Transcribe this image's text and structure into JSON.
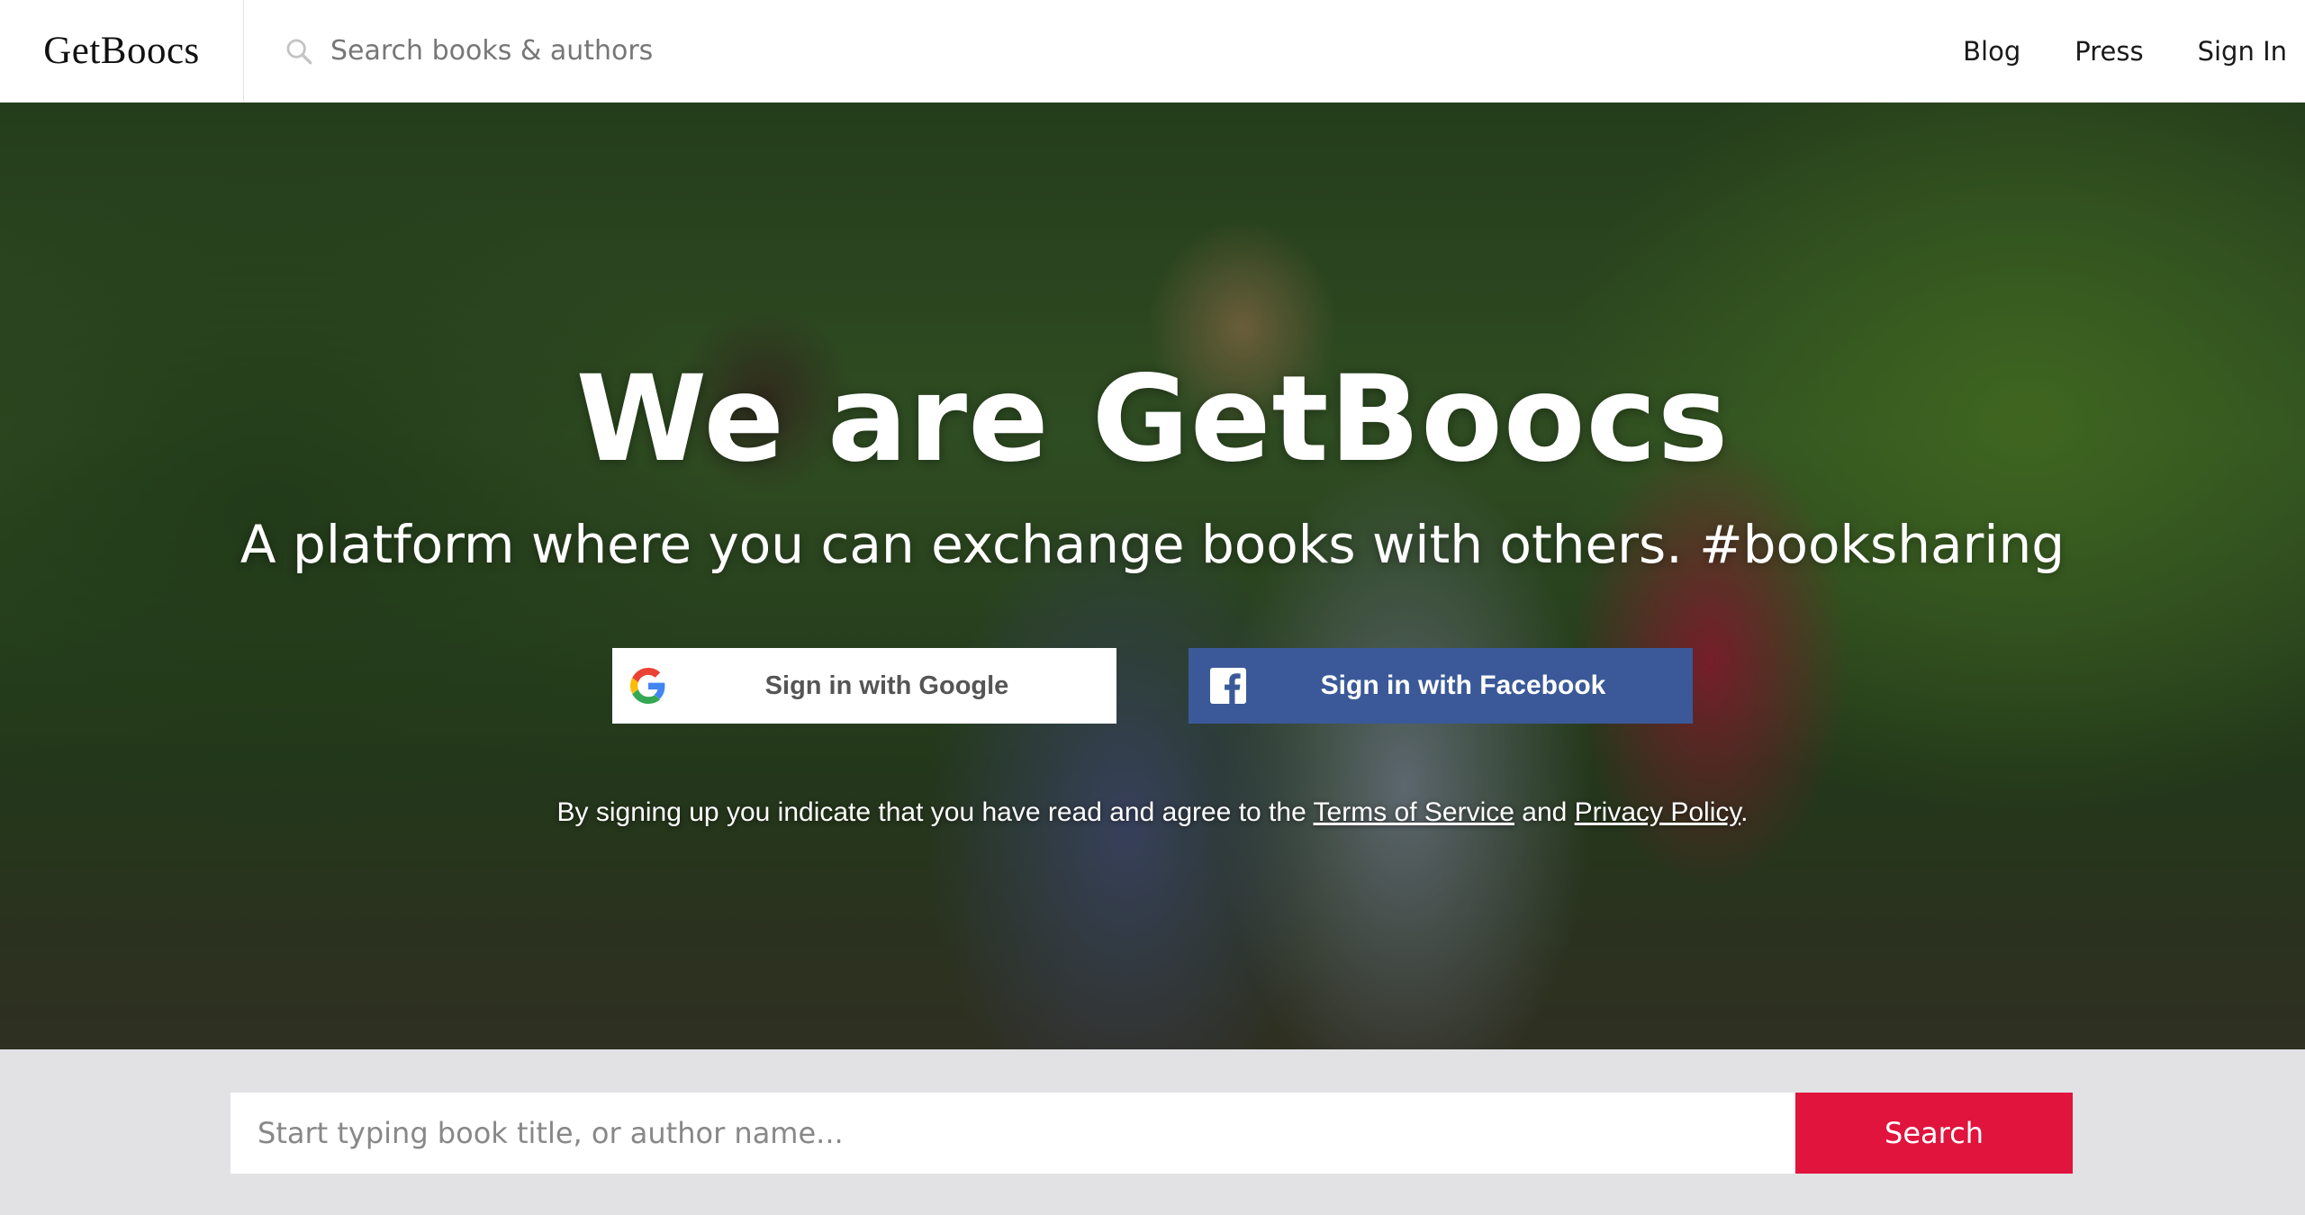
{
  "header": {
    "logo": "GetBoocs",
    "search_placeholder": "Search books & authors",
    "nav": {
      "blog": "Blog",
      "press": "Press",
      "sign_in": "Sign In"
    }
  },
  "hero": {
    "title": "We are GetBoocs",
    "subtitle": "A platform where you can exchange books with others. #booksharing",
    "google_button": "Sign in with Google",
    "facebook_button": "Sign in with Facebook",
    "terms": {
      "prefix": "By signing up you indicate that you have read and agree to the ",
      "tos_link": "Terms of Service",
      "and": " and ",
      "privacy_link": "Privacy Policy",
      "suffix": "."
    }
  },
  "bottom_search": {
    "placeholder": "Start typing book title, or author name...",
    "button": "Search"
  },
  "colors": {
    "facebook_blue": "#3b5998",
    "search_red": "#e0143c"
  }
}
